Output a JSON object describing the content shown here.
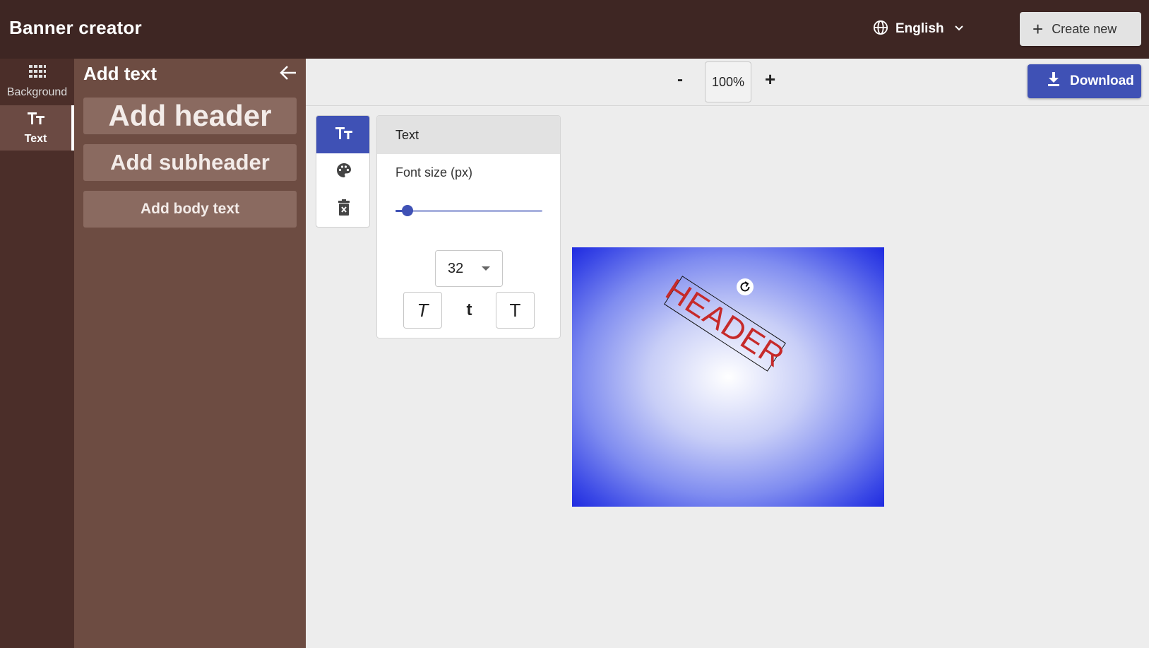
{
  "app": {
    "title": "Banner creator"
  },
  "header": {
    "language": "English",
    "create_label": "Create new",
    "language_icon": "globe-icon",
    "create_icon": "plus-icon"
  },
  "rail": {
    "items": [
      {
        "label": "Background",
        "icon": "grid-icon",
        "active": false
      },
      {
        "label": "Text",
        "icon": "text-size-icon",
        "active": true
      }
    ]
  },
  "panel": {
    "title": "Add text",
    "back_icon": "arrow-left-icon",
    "buttons": [
      {
        "label": "Add header"
      },
      {
        "label": "Add subheader"
      },
      {
        "label": "Add body text"
      }
    ]
  },
  "zoom": {
    "minus_label": "-",
    "value": "100%",
    "plus_label": "+"
  },
  "download": {
    "label": "Download",
    "icon": "download-icon"
  },
  "tool_tabs": [
    {
      "icon": "text-size-icon",
      "active": true
    },
    {
      "icon": "palette-icon",
      "active": false
    },
    {
      "icon": "delete-icon",
      "active": false
    }
  ],
  "text_panel": {
    "title": "Text",
    "font_size_label": "Font size (px)",
    "slider_fraction": 0.08,
    "font_size": "32",
    "style_buttons": [
      {
        "label": "T",
        "style": "italic"
      },
      {
        "label": "t",
        "style": "lowercase"
      },
      {
        "label": "T",
        "style": "uppercase"
      }
    ]
  },
  "canvas": {
    "text": "HEADER",
    "text_color": "#c62a2a",
    "rotate_icon": "rotate-icon"
  },
  "colors": {
    "topbar": "#3e2623",
    "rail": "#4b2e29",
    "panel": "#6d4c42",
    "accent": "#3f51b5"
  }
}
